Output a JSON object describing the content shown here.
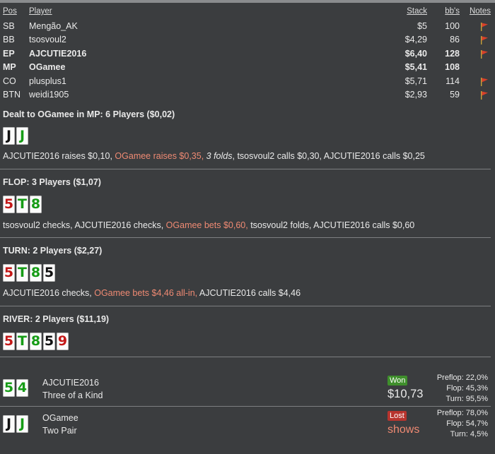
{
  "headers": {
    "pos": "Pos",
    "player": "Player",
    "stack": "Stack",
    "bbs": "bb's",
    "notes": "Notes"
  },
  "players": [
    {
      "pos": "SB",
      "name": "Mengão_AK",
      "stack": "$5",
      "bb": "100",
      "bold": false,
      "flag": true
    },
    {
      "pos": "BB",
      "name": "tsosvoul2",
      "stack": "$4,29",
      "bb": "86",
      "bold": false,
      "flag": true
    },
    {
      "pos": "EP",
      "name": "AJCUTIE2016",
      "stack": "$6,40",
      "bb": "128",
      "bold": true,
      "flag": true
    },
    {
      "pos": "MP",
      "name": "OGamee",
      "stack": "$5,41",
      "bb": "108",
      "bold": true,
      "flag": false
    },
    {
      "pos": "CO",
      "name": "plusplus1",
      "stack": "$5,71",
      "bb": "114",
      "bold": false,
      "flag": true
    },
    {
      "pos": "BTN",
      "name": "weidi1905",
      "stack": "$2,93",
      "bb": "59",
      "bold": false,
      "flag": true
    }
  ],
  "preflop": {
    "title": "Dealt to OGamee in MP: 6 Players ($0,02)",
    "cards": [
      {
        "rank": "J",
        "suit": "s"
      },
      {
        "rank": "J",
        "suit": "c"
      }
    ],
    "actions": {
      "a1": "AJCUTIE2016 raises $0,10, ",
      "a2": "OGamee raises $0,35, ",
      "a3": "3 folds",
      "a4": ", tsosvoul2 calls $0,30, AJCUTIE2016 calls $0,25"
    }
  },
  "flop": {
    "title": "FLOP: 3 Players ($1,07)",
    "cards": [
      {
        "rank": "5",
        "suit": "h"
      },
      {
        "rank": "T",
        "suit": "c"
      },
      {
        "rank": "8",
        "suit": "c"
      }
    ],
    "actions": {
      "a1": "tsosvoul2 checks, AJCUTIE2016 checks, ",
      "a2": "OGamee bets $0,60,",
      "a3": " tsosvoul2 folds, AJCUTIE2016 calls $0,60"
    }
  },
  "turn": {
    "title": "TURN: 2 Players ($2,27)",
    "cards": [
      {
        "rank": "5",
        "suit": "h"
      },
      {
        "rank": "T",
        "suit": "c"
      },
      {
        "rank": "8",
        "suit": "c"
      },
      {
        "rank": "5",
        "suit": "s"
      }
    ],
    "actions": {
      "a1": "AJCUTIE2016 checks, ",
      "a2": "OGamee bets $4,46 all-in,",
      "a3": " AJCUTIE2016 calls $4,46"
    }
  },
  "river": {
    "title": "RIVER: 2 Players ($11,19)",
    "cards": [
      {
        "rank": "5",
        "suit": "h"
      },
      {
        "rank": "T",
        "suit": "c"
      },
      {
        "rank": "8",
        "suit": "c"
      },
      {
        "rank": "5",
        "suit": "s"
      },
      {
        "rank": "9",
        "suit": "h"
      }
    ]
  },
  "showdown": [
    {
      "name": "AJCUTIE2016",
      "hand": "Three of a Kind",
      "result": "Won",
      "amount": "$10,73",
      "cards": [
        {
          "rank": "5",
          "suit": "c"
        },
        {
          "rank": "4",
          "suit": "c"
        }
      ],
      "eq": {
        "pre_l": "Preflop:",
        "pre": "22,0%",
        "flop_l": "Flop:",
        "flop": "45,3%",
        "turn_l": "Turn:",
        "turn": "95,5%"
      }
    },
    {
      "name": "OGamee",
      "hand": "Two Pair",
      "result": "Lost",
      "amount": "shows",
      "cards": [
        {
          "rank": "J",
          "suit": "s"
        },
        {
          "rank": "J",
          "suit": "c"
        }
      ],
      "eq": {
        "pre_l": "Preflop:",
        "pre": "78,0%",
        "flop_l": "Flop:",
        "flop": "54,7%",
        "turn_l": "Turn:",
        "turn": "4,5%"
      }
    }
  ],
  "colors": {
    "hero": "#ef8a73",
    "won": "#3f8f2c",
    "lost": "#b8342e",
    "background": "#3b3d3f"
  }
}
